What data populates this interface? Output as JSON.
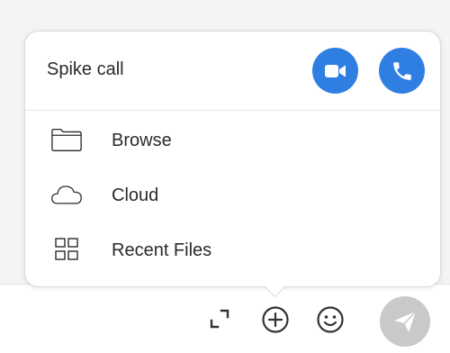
{
  "popover": {
    "title": "Spike call",
    "video_call_icon": "video-camera-icon",
    "audio_call_icon": "phone-icon",
    "items": [
      {
        "label": "Browse",
        "icon": "folder-icon"
      },
      {
        "label": "Cloud",
        "icon": "cloud-icon"
      },
      {
        "label": "Recent Files",
        "icon": "grid-icon"
      }
    ]
  },
  "toolbar": {
    "icons": [
      "expand-icon",
      "add-circle-icon",
      "smiley-icon",
      "send-icon"
    ]
  },
  "colors": {
    "accent": "#2f7fe3",
    "send_button": "#c9c9c9",
    "background": "#f4f4f5"
  }
}
